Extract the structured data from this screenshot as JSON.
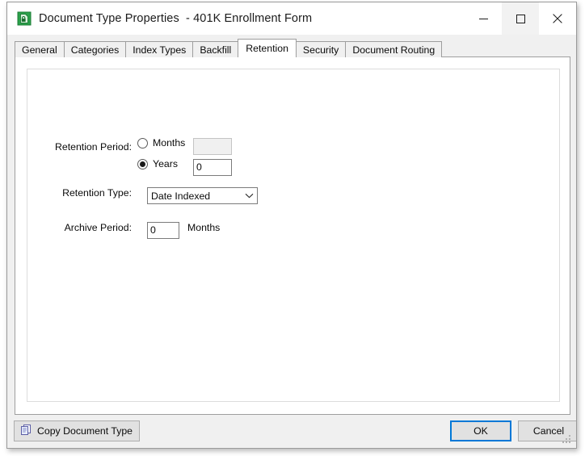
{
  "window": {
    "title": "Document Type Properties  - 401K Enrollment Form",
    "icon": "document-lock-icon",
    "accent_color": "#0078d7",
    "controls": {
      "minimize": "minimize-icon",
      "maximize": "maximize-icon",
      "close": "close-icon"
    }
  },
  "tabs": [
    {
      "label": "General",
      "selected": false
    },
    {
      "label": "Categories",
      "selected": false
    },
    {
      "label": "Index Types",
      "selected": false
    },
    {
      "label": "Backfill",
      "selected": false
    },
    {
      "label": "Retention",
      "selected": true
    },
    {
      "label": "Security",
      "selected": false
    },
    {
      "label": "Document Routing",
      "selected": false
    }
  ],
  "retention_tab": {
    "retention_period": {
      "label": "Retention Period:",
      "options": [
        {
          "label": "Months",
          "selected": false,
          "value": "",
          "enabled": false
        },
        {
          "label": "Years",
          "selected": true,
          "value": "0",
          "enabled": true
        }
      ]
    },
    "retention_type": {
      "label": "Retention Type:",
      "value": "Date Indexed",
      "arrow_icon": "chevron-down-icon"
    },
    "archive_period": {
      "label": "Archive Period:",
      "value": "0",
      "unit": "Months"
    }
  },
  "footer": {
    "copy_button": {
      "label": "Copy Document Type",
      "icon": "copy-documents-icon"
    },
    "ok_button": {
      "label": "OK",
      "focused": true
    },
    "cancel_button": {
      "label": "Cancel"
    },
    "resize_grip": "resize-grip-icon"
  }
}
